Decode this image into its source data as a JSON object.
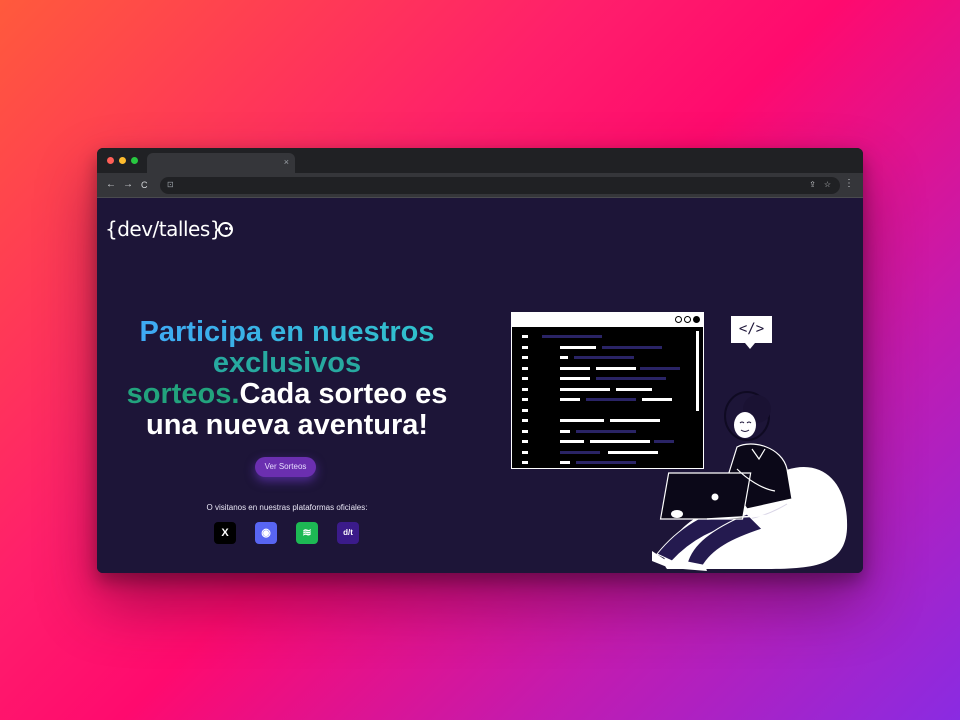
{
  "browser": {
    "tab_close": "×",
    "back": "←",
    "forward": "→",
    "reload": "C",
    "lock": "🔒",
    "share": "⇪",
    "star": "☆",
    "menu": "⋮"
  },
  "logo": {
    "text": "{dev/talles}"
  },
  "hero": {
    "line1": "Participa en nuestros",
    "line2": "exclusivos",
    "line3a": "sorteos.",
    "line3b": "Cada sorteo es",
    "line4": "una nueva aventura!"
  },
  "cta": {
    "label": "Ver Sorteos"
  },
  "platforms": {
    "label": "O visitanos en nuestras plataformas oficiales:",
    "items": [
      {
        "icon": "x-icon",
        "glyph": "X"
      },
      {
        "icon": "discord-icon",
        "glyph": "◉"
      },
      {
        "icon": "spotify-icon",
        "glyph": "≋"
      },
      {
        "icon": "devtalles-icon",
        "glyph": "d/t"
      }
    ]
  },
  "illustration": {
    "bubble": "</>"
  },
  "colors": {
    "page_bg": "#1d1538",
    "cta": "#6b2fb0",
    "heading_blue": "#3fa9f5",
    "heading_teal": "#22a37d"
  }
}
